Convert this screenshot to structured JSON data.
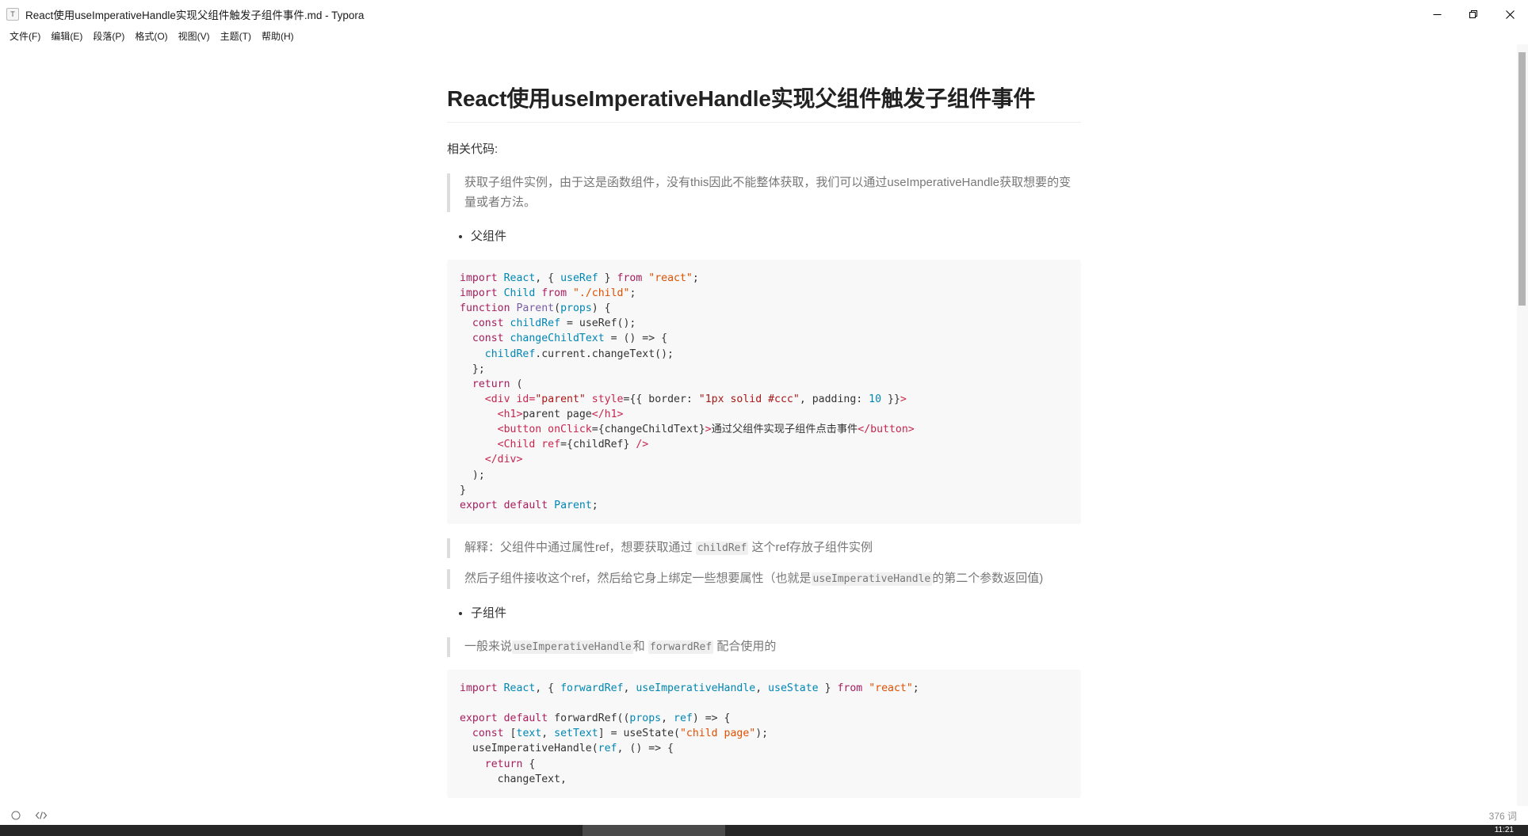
{
  "window": {
    "icon": "typora-doc-icon",
    "title": "React使用useImperativeHandle实现父组件触发子组件事件.md - Typora",
    "controls": {
      "minimize": "minimize-icon",
      "restore": "restore-icon",
      "close": "close-icon"
    }
  },
  "menubar": {
    "items": [
      {
        "label": "文件(F)"
      },
      {
        "label": "编辑(E)"
      },
      {
        "label": "段落(P)"
      },
      {
        "label": "格式(O)"
      },
      {
        "label": "视图(V)"
      },
      {
        "label": "主题(T)"
      },
      {
        "label": "帮助(H)"
      }
    ]
  },
  "document": {
    "title": "React使用useImperativeHandle实现父组件触发子组件事件",
    "intro_paragraph": "相关代码:",
    "quote_intro": "获取子组件实例，由于这是函数组件，没有this因此不能整体获取，我们可以通过useImperativeHandle获取想要的变量或者方法。",
    "list_parent_label": "父组件",
    "list_child_label": "子组件",
    "quote_explain_prefix": "解释：父组件中通过属性ref，想要获取通过 ",
    "quote_explain_code": "childRef",
    "quote_explain_suffix": " 这个ref存放子组件实例",
    "quote_second_prefix": "然后子组件接收这个ref，然后给它身上绑定一些想要属性（也就是",
    "quote_second_code": "useImperativeHandle",
    "quote_second_suffix": "的第二个参数返回值)",
    "quote_child_prefix": "一般来说",
    "quote_child_code1": "useImperativeHandle",
    "quote_child_mid": "和 ",
    "quote_child_code2": "forwardRef",
    "quote_child_suffix": " 配合使用的",
    "code_parent": [
      "import React, { useRef } from \"react\";",
      "import Child from \"./child\";",
      "function Parent(props) {",
      "  const childRef = useRef();",
      "  const changeChildText = () => {",
      "    childRef.current.changeText();",
      "  };",
      "  return (",
      "    <div id=\"parent\" style={{ border: \"1px solid #ccc\", padding: 10 }}>",
      "      <h1>parent page</h1>",
      "      <button onClick={changeChildText}>通过父组件实现子组件点击事件</button>",
      "      <Child ref={childRef} />",
      "    </div>",
      "  );",
      "}",
      "export default Parent;"
    ],
    "code_child": [
      "import React, { forwardRef, useImperativeHandle, useState } from \"react\";",
      "",
      "export default forwardRef((props, ref) => {",
      "  const [text, setText] = useState(\"child page\");",
      "  useImperativeHandle(ref, () => {",
      "    return {",
      "      changeText,"
    ]
  },
  "statusbar": {
    "source_mode_icon": "circle-icon",
    "code_view_icon": "source-code-icon",
    "word_count": "376 词"
  },
  "taskbar": {
    "clock": "11:21"
  },
  "colors": {
    "accent": "#4a4a4a",
    "code_bg": "#f8f8f8",
    "quote_border": "#dddddd",
    "text": "#333333"
  }
}
